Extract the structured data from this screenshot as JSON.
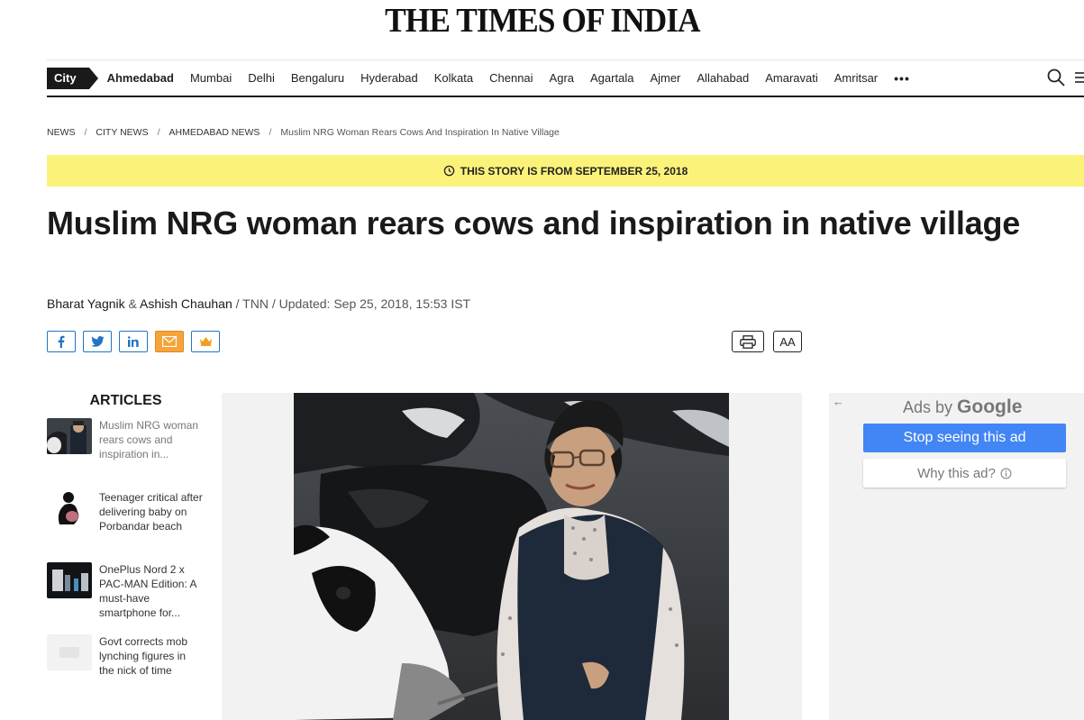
{
  "masthead": {
    "logo": "THE TIMES OF INDIA"
  },
  "nav": {
    "city_tag": "City",
    "items": [
      "Ahmedabad",
      "Mumbai",
      "Delhi",
      "Bengaluru",
      "Hyderabad",
      "Kolkata",
      "Chennai",
      "Agra",
      "Agartala",
      "Ajmer",
      "Allahabad",
      "Amaravati",
      "Amritsar"
    ],
    "active": "Ahmedabad",
    "more": "•••"
  },
  "breadcrumb": [
    "NEWS",
    "CITY NEWS",
    "AHMEDABAD NEWS",
    "Muslim NRG Woman Rears Cows And Inspiration In Native Village"
  ],
  "story_banner": {
    "text": "THIS STORY IS FROM SEPTEMBER 25, 2018",
    "color": "#fbf27a"
  },
  "headline": "Muslim NRG woman rears cows and inspiration in native village",
  "byline": {
    "author1": "Bharat Yagnik",
    "and": " & ",
    "author2": "Ashish Chauhan",
    "rest": " / TNN / Updated: Sep 25, 2018, 15:53 IST"
  },
  "share": {
    "icons": [
      "facebook-icon",
      "twitter-icon",
      "linkedin-icon",
      "mail-icon",
      "crown-icon"
    ]
  },
  "tools": {
    "print_icon": "printer-icon",
    "font_label": "AA"
  },
  "articles": {
    "heading": "ARTICLES",
    "items": [
      {
        "title": "Muslim NRG woman rears cows and inspiration in..."
      },
      {
        "title": "Teenager critical after delivering baby on Porbandar beach"
      },
      {
        "title": "OnePlus Nord 2 x PAC-MAN Edition: A must-have smartphone for..."
      },
      {
        "title": "Govt corrects mob lynching figures in the nick of time"
      }
    ]
  },
  "ad": {
    "ads_by": "Ads by",
    "google": "Google",
    "stop_label": "Stop seeing this ad",
    "why_label": "Why this ad?",
    "accent": "#4285f4"
  }
}
